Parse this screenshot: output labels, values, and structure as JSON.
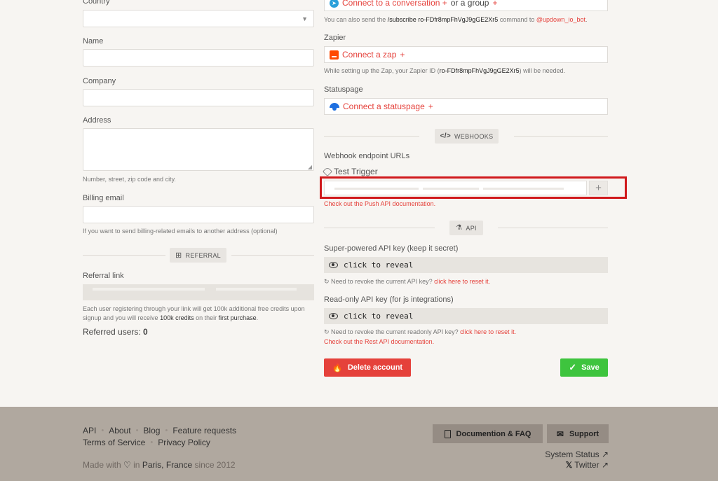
{
  "left": {
    "country_label": "Country",
    "name_label": "Name",
    "company_label": "Company",
    "address_label": "Address",
    "address_help": "Number, street, zip code and city.",
    "billing_label": "Billing email",
    "billing_help": "If you want to send billing-related emails to another address (optional)",
    "referral_section": "REFERRAL",
    "referral_label": "Referral link",
    "referral_help_1": "Each user registering through your link will get 100k additional free credits upon signup and you will receive ",
    "referral_help_bold": "100k credits",
    "referral_help_2": " on their ",
    "referral_help_3": "first purchase",
    "referral_help_4": ".",
    "referred_label": "Referred users: ",
    "referred_count": "0"
  },
  "right": {
    "telegram": {
      "connect": "Connect to a conversation",
      "or": "or a group",
      "help_1": "You can also send the ",
      "command": "/subscribe ro-FDfr8mpFhVgJ9gGE2Xr5",
      "help_2": " command to ",
      "bot": "@updown_io_bot",
      "help_3": "."
    },
    "zapier": {
      "label": "Zapier",
      "connect": "Connect a zap",
      "help_1": "While setting up the Zap, your Zapier ID (",
      "id": "ro-FDfr8mpFhVgJ9gGE2Xr5",
      "help_2": ") will be needed."
    },
    "statuspage": {
      "label": "Statuspage",
      "connect": "Connect a statuspage"
    },
    "webhooks": {
      "section": "WEBHOOKS",
      "label": "Webhook endpoint URLs",
      "test": "Test Trigger",
      "push_doc": "Check out the Push API documentation."
    },
    "api": {
      "section": "API",
      "full_label": "Super-powered API key (keep it secret)",
      "reveal": "click to reveal",
      "full_revoke_1": "Need to revoke the current API key? ",
      "full_revoke_link": "click here to reset it.",
      "ro_label": "Read-only API key (for js integrations)",
      "ro_revoke_1": "Need to revoke the current readonly API key? ",
      "ro_revoke_link": "click here to reset it.",
      "rest_doc": "Check out the Rest API documentation."
    },
    "delete": "Delete account",
    "save": "Save"
  },
  "footer": {
    "links": [
      "API",
      "About",
      "Blog",
      "Feature requests"
    ],
    "links2": [
      "Terms of Service",
      "Privacy Policy"
    ],
    "made_1": "Made with ",
    "made_2": " in ",
    "made_city": "Paris, France",
    "made_3": " since 2012",
    "docs": "Documention & FAQ",
    "support": "Support",
    "status": "System Status ↗",
    "twitter": "Twitter ↗"
  },
  "colors": {
    "accent": "#e5413b",
    "save": "#3ec43e",
    "footer": "#b0a89f",
    "highlight": "#d0191c"
  }
}
